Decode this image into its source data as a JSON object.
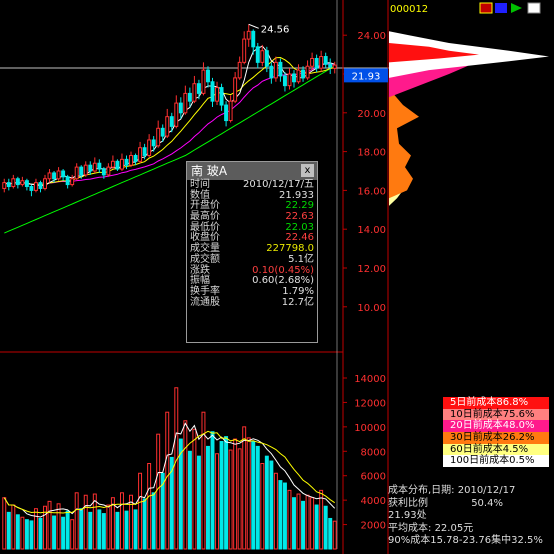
{
  "header": {
    "code": "000012"
  },
  "price_labels": {
    "high_marker": "24.56",
    "current_price": "21.93",
    "axis_ticks": [
      "24.00",
      "22.00",
      "20.00",
      "18.00",
      "16.00",
      "14.00",
      "12.00",
      "10.00"
    ]
  },
  "volume_axis_ticks": [
    "14000",
    "12000",
    "10000",
    "8000",
    "6000",
    "4000",
    "2000"
  ],
  "info_panel": {
    "title": "南 玻A",
    "close": "x",
    "rows": [
      {
        "label": "时间",
        "value": "2010/12/17/五",
        "color": "#e0e0e0"
      },
      {
        "label": "数值",
        "value": "21.933",
        "color": "#e0e0e0"
      },
      {
        "label": "开盘价",
        "value": "22.29",
        "color": "#00d800"
      },
      {
        "label": "最高价",
        "value": "22.63",
        "color": "#ff4040"
      },
      {
        "label": "最低价",
        "value": "22.03",
        "color": "#00d800"
      },
      {
        "label": "收盘价",
        "value": "22.46",
        "color": "#ff4040"
      },
      {
        "label": "成交量",
        "value": "227798.0",
        "color": "#e8e800"
      },
      {
        "label": "成交额",
        "value": "5.1亿",
        "color": "#e0e0e0"
      },
      {
        "label": "涨跌",
        "value": "0.10(0.45%)",
        "color": "#ff4040"
      },
      {
        "label": "振幅",
        "value": "0.60(2.68%)",
        "color": "#e0e0e0"
      },
      {
        "label": "换手率",
        "value": "1.79%",
        "color": "#e0e0e0"
      },
      {
        "label": "流通股",
        "value": "12.7亿",
        "color": "#e0e0e0"
      }
    ]
  },
  "cost_legend": [
    {
      "label": "5日前成本86.8%",
      "bg": "#ff1010",
      "fg": "#ffffff"
    },
    {
      "label": "10日前成本75.6%",
      "bg": "#ff8080",
      "fg": "#000000"
    },
    {
      "label": "20日前成本48.0%",
      "bg": "#ff1a8c",
      "fg": "#ffffff"
    },
    {
      "label": "30日前成本26.2%",
      "bg": "#ff7a10",
      "fg": "#000000"
    },
    {
      "label": "60日前成本4.5%",
      "bg": "#ffff80",
      "fg": "#000000"
    },
    {
      "label": "100日前成本0.5%",
      "bg": "#ffffff",
      "fg": "#000000"
    }
  ],
  "cost_info": {
    "line1": "成本分布,日期: 2010/12/17",
    "line2_label": "获利比例",
    "line2_value": "50.4%",
    "line3": "21.93处",
    "line4": "平均成本:",
    "line4_value": "22.05元",
    "line5": "90%成本15.78-23.76集中32.5%"
  },
  "colors": {
    "up": "#ff3030",
    "down": "#00e8e8",
    "ma5": "#ffffff",
    "ma10": "#ffff00",
    "ma20": "#ff00ff",
    "ma60": "#00ff00",
    "axis": "#c00000",
    "price_box": "#0050e8"
  },
  "chart_data": {
    "type": "candlestick",
    "price_axis": {
      "min": 10,
      "max": 24,
      "ticks": [
        24,
        22,
        20,
        18,
        16,
        14,
        12,
        10
      ]
    },
    "volume_axis": {
      "min": 0,
      "max": 14000,
      "ticks": [
        14000,
        12000,
        10000,
        8000,
        6000,
        4000,
        2000
      ]
    },
    "high_marker": 24.56,
    "current_price": 21.93,
    "candles": [
      {
        "o": 16.1,
        "c": 16.4,
        "h": 16.6,
        "l": 15.9,
        "v": 4200
      },
      {
        "o": 16.4,
        "c": 16.2,
        "h": 16.6,
        "l": 16.0,
        "v": 3000
      },
      {
        "o": 16.2,
        "c": 16.6,
        "h": 16.8,
        "l": 16.1,
        "v": 3600
      },
      {
        "o": 16.6,
        "c": 16.3,
        "h": 16.7,
        "l": 16.1,
        "v": 2800
      },
      {
        "o": 16.3,
        "c": 16.5,
        "h": 16.7,
        "l": 16.2,
        "v": 2600
      },
      {
        "o": 16.5,
        "c": 16.2,
        "h": 16.6,
        "l": 16.0,
        "v": 2400
      },
      {
        "o": 16.2,
        "c": 16.0,
        "h": 16.3,
        "l": 15.7,
        "v": 2300
      },
      {
        "o": 16.0,
        "c": 16.4,
        "h": 16.6,
        "l": 15.9,
        "v": 3300
      },
      {
        "o": 16.4,
        "c": 16.1,
        "h": 16.5,
        "l": 15.9,
        "v": 2500
      },
      {
        "o": 16.1,
        "c": 16.6,
        "h": 16.8,
        "l": 16.0,
        "v": 3500
      },
      {
        "o": 16.6,
        "c": 16.9,
        "h": 17.1,
        "l": 16.4,
        "v": 3900
      },
      {
        "o": 16.9,
        "c": 16.6,
        "h": 17.0,
        "l": 16.4,
        "v": 2700
      },
      {
        "o": 16.6,
        "c": 17.0,
        "h": 17.2,
        "l": 16.5,
        "v": 3700
      },
      {
        "o": 17.0,
        "c": 16.7,
        "h": 17.1,
        "l": 16.5,
        "v": 2600
      },
      {
        "o": 16.7,
        "c": 16.3,
        "h": 16.8,
        "l": 16.1,
        "v": 3100
      },
      {
        "o": 16.3,
        "c": 16.6,
        "h": 16.8,
        "l": 16.2,
        "v": 2400
      },
      {
        "o": 16.6,
        "c": 17.2,
        "h": 17.4,
        "l": 16.5,
        "v": 4600
      },
      {
        "o": 17.2,
        "c": 16.8,
        "h": 17.3,
        "l": 16.6,
        "v": 3300
      },
      {
        "o": 16.8,
        "c": 17.3,
        "h": 17.5,
        "l": 16.7,
        "v": 4400
      },
      {
        "o": 17.3,
        "c": 17.0,
        "h": 17.5,
        "l": 16.8,
        "v": 3000
      },
      {
        "o": 17.0,
        "c": 17.4,
        "h": 17.7,
        "l": 16.9,
        "v": 4500
      },
      {
        "o": 17.4,
        "c": 17.1,
        "h": 17.6,
        "l": 16.9,
        "v": 3200
      },
      {
        "o": 17.1,
        "c": 16.8,
        "h": 17.2,
        "l": 16.6,
        "v": 2900
      },
      {
        "o": 16.8,
        "c": 17.2,
        "h": 17.4,
        "l": 16.7,
        "v": 3600
      },
      {
        "o": 17.2,
        "c": 17.5,
        "h": 17.8,
        "l": 17.1,
        "v": 4200
      },
      {
        "o": 17.5,
        "c": 17.1,
        "h": 17.6,
        "l": 17.0,
        "v": 3000
      },
      {
        "o": 17.1,
        "c": 17.6,
        "h": 17.9,
        "l": 17.0,
        "v": 4600
      },
      {
        "o": 17.6,
        "c": 17.3,
        "h": 17.8,
        "l": 17.1,
        "v": 3100
      },
      {
        "o": 17.3,
        "c": 17.8,
        "h": 18.0,
        "l": 17.2,
        "v": 4400
      },
      {
        "o": 17.8,
        "c": 17.5,
        "h": 17.9,
        "l": 17.3,
        "v": 3200
      },
      {
        "o": 17.5,
        "c": 18.2,
        "h": 18.5,
        "l": 17.4,
        "v": 6200
      },
      {
        "o": 18.2,
        "c": 17.8,
        "h": 18.4,
        "l": 17.6,
        "v": 4100
      },
      {
        "o": 17.8,
        "c": 18.6,
        "h": 18.9,
        "l": 17.7,
        "v": 7000
      },
      {
        "o": 18.6,
        "c": 18.3,
        "h": 18.8,
        "l": 18.0,
        "v": 4600
      },
      {
        "o": 18.3,
        "c": 19.2,
        "h": 19.6,
        "l": 18.2,
        "v": 9400
      },
      {
        "o": 19.2,
        "c": 18.8,
        "h": 19.4,
        "l": 18.5,
        "v": 6200
      },
      {
        "o": 18.8,
        "c": 19.8,
        "h": 20.2,
        "l": 18.7,
        "v": 11200
      },
      {
        "o": 19.8,
        "c": 19.3,
        "h": 20.0,
        "l": 19.0,
        "v": 7500
      },
      {
        "o": 19.3,
        "c": 20.5,
        "h": 20.9,
        "l": 19.2,
        "v": 13200
      },
      {
        "o": 20.5,
        "c": 20.0,
        "h": 20.8,
        "l": 19.7,
        "v": 9000
      },
      {
        "o": 20.0,
        "c": 21.0,
        "h": 21.4,
        "l": 19.9,
        "v": 10500
      },
      {
        "o": 21.0,
        "c": 20.6,
        "h": 21.3,
        "l": 20.3,
        "v": 8000
      },
      {
        "o": 20.6,
        "c": 21.5,
        "h": 21.9,
        "l": 20.5,
        "v": 9800
      },
      {
        "o": 21.5,
        "c": 21.0,
        "h": 21.7,
        "l": 20.7,
        "v": 7600
      },
      {
        "o": 21.0,
        "c": 22.2,
        "h": 22.6,
        "l": 20.9,
        "v": 11200
      },
      {
        "o": 22.2,
        "c": 21.6,
        "h": 22.4,
        "l": 21.3,
        "v": 8400
      },
      {
        "o": 21.6,
        "c": 20.6,
        "h": 21.8,
        "l": 20.3,
        "v": 9600
      },
      {
        "o": 20.6,
        "c": 21.3,
        "h": 21.6,
        "l": 20.4,
        "v": 7800
      },
      {
        "o": 21.3,
        "c": 20.4,
        "h": 21.5,
        "l": 20.1,
        "v": 8800
      },
      {
        "o": 20.4,
        "c": 19.6,
        "h": 20.6,
        "l": 19.3,
        "v": 9200
      },
      {
        "o": 19.6,
        "c": 20.6,
        "h": 20.9,
        "l": 19.5,
        "v": 8100
      },
      {
        "o": 20.6,
        "c": 21.8,
        "h": 22.1,
        "l": 20.5,
        "v": 9000
      },
      {
        "o": 21.8,
        "c": 22.6,
        "h": 22.9,
        "l": 21.7,
        "v": 8200
      },
      {
        "o": 22.6,
        "c": 23.8,
        "h": 24.2,
        "l": 22.5,
        "v": 10000
      },
      {
        "o": 23.8,
        "c": 24.2,
        "h": 24.56,
        "l": 23.4,
        "v": 9100
      },
      {
        "o": 24.2,
        "c": 23.4,
        "h": 24.3,
        "l": 23.0,
        "v": 8800
      },
      {
        "o": 23.4,
        "c": 22.6,
        "h": 23.6,
        "l": 22.3,
        "v": 8400
      },
      {
        "o": 22.6,
        "c": 23.2,
        "h": 23.5,
        "l": 22.4,
        "v": 7000
      },
      {
        "o": 23.2,
        "c": 22.4,
        "h": 23.4,
        "l": 22.1,
        "v": 7600
      },
      {
        "o": 22.4,
        "c": 21.8,
        "h": 22.6,
        "l": 21.5,
        "v": 7200
      },
      {
        "o": 21.8,
        "c": 22.6,
        "h": 22.9,
        "l": 21.6,
        "v": 6200
      },
      {
        "o": 22.6,
        "c": 21.9,
        "h": 22.8,
        "l": 21.6,
        "v": 5600
      },
      {
        "o": 21.9,
        "c": 21.4,
        "h": 22.1,
        "l": 21.1,
        "v": 5400
      },
      {
        "o": 21.4,
        "c": 22.0,
        "h": 22.3,
        "l": 21.2,
        "v": 4800
      },
      {
        "o": 22.0,
        "c": 21.6,
        "h": 22.2,
        "l": 21.3,
        "v": 4200
      },
      {
        "o": 21.6,
        "c": 22.2,
        "h": 22.5,
        "l": 21.5,
        "v": 4500
      },
      {
        "o": 22.2,
        "c": 21.8,
        "h": 22.4,
        "l": 21.6,
        "v": 3900
      },
      {
        "o": 21.8,
        "c": 22.4,
        "h": 22.7,
        "l": 21.7,
        "v": 4400
      },
      {
        "o": 22.4,
        "c": 22.8,
        "h": 23.1,
        "l": 22.2,
        "v": 4200
      },
      {
        "o": 22.8,
        "c": 22.3,
        "h": 23.0,
        "l": 22.1,
        "v": 3600
      },
      {
        "o": 22.3,
        "c": 22.9,
        "h": 23.2,
        "l": 22.1,
        "v": 4800
      },
      {
        "o": 22.9,
        "c": 22.5,
        "h": 23.1,
        "l": 22.3,
        "v": 3500
      },
      {
        "o": 22.5,
        "c": 22.36,
        "h": 22.8,
        "l": 22.0,
        "v": 2500
      },
      {
        "o": 22.29,
        "c": 22.46,
        "h": 22.63,
        "l": 22.03,
        "v": 2277
      }
    ]
  }
}
